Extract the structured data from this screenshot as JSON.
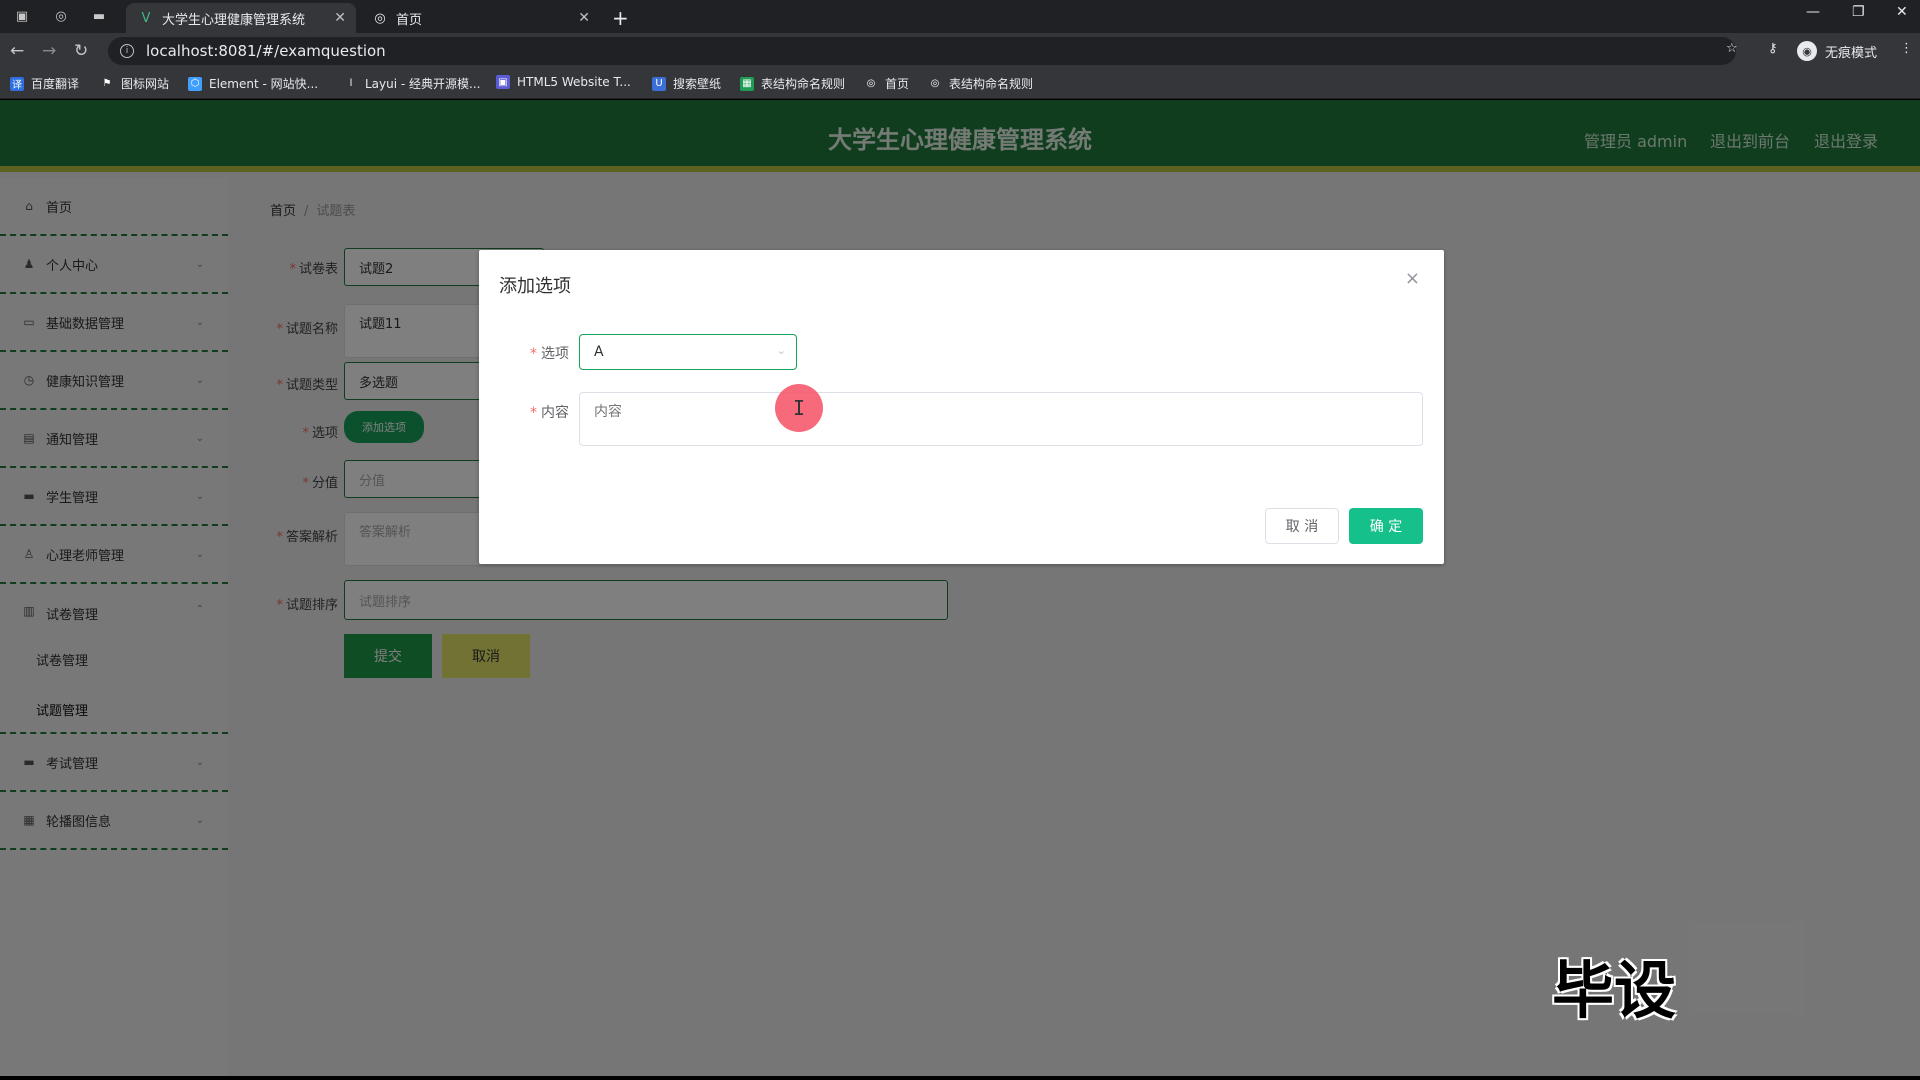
{
  "browser": {
    "tabs": [
      {
        "label": "大学生心理健康管理系统",
        "active": true
      },
      {
        "label": "首页",
        "active": false
      }
    ],
    "url": "localhost:8081/#/examquestion",
    "incognito_label": "无痕模式",
    "bookmarks": [
      {
        "label": "百度翻译",
        "color": "#2f6fe0",
        "glyph": "译"
      },
      {
        "label": "图标网站",
        "color": "#35363a",
        "glyph": "⚑"
      },
      {
        "label": "Element - 网站快...",
        "color": "#409eff",
        "glyph": "⬡"
      },
      {
        "label": "Layui - 经典开源模...",
        "color": "#35363a",
        "glyph": "l"
      },
      {
        "label": "HTML5 Website T...",
        "color": "#5b5bd6",
        "glyph": "▣"
      },
      {
        "label": "搜索壁纸",
        "color": "#3a6fd8",
        "glyph": "U"
      },
      {
        "label": "表结构命名规则",
        "color": "#1f9d55",
        "glyph": "▦"
      },
      {
        "label": "首页",
        "color": "#35363a",
        "glyph": "◎"
      },
      {
        "label": "表结构命名规则",
        "color": "#35363a",
        "glyph": "◎"
      }
    ]
  },
  "header": {
    "title": "大学生心理健康管理系统",
    "admin": "管理员 admin",
    "front": "退出到前台",
    "logout": "退出登录"
  },
  "sidebar": {
    "items": [
      {
        "label": "首页",
        "icon": "⌂"
      },
      {
        "label": "个人中心",
        "icon": "♟"
      },
      {
        "label": "基础数据管理",
        "icon": "▭"
      },
      {
        "label": "健康知识管理",
        "icon": "◷"
      },
      {
        "label": "通知管理",
        "icon": "▤"
      },
      {
        "label": "学生管理",
        "icon": "▬"
      },
      {
        "label": "心理老师管理",
        "icon": "♙"
      },
      {
        "label": "试卷管理",
        "icon": "▥"
      }
    ],
    "sub_items": [
      "试卷管理",
      "试题管理"
    ],
    "items_after": [
      {
        "label": "考试管理",
        "icon": "▬"
      },
      {
        "label": "轮播图信息",
        "icon": "▦"
      }
    ]
  },
  "breadcrumb": {
    "home": "首页",
    "sep": "/",
    "current": "试题表"
  },
  "form": {
    "paper_label": "试卷表",
    "paper_value": "试题2",
    "name_label": "试题名称",
    "name_value": "试题11",
    "type_label": "试题类型",
    "type_value": "多选题",
    "option_label": "选项",
    "add_option": "添加选项",
    "score_label": "分值",
    "score_placeholder": "分值",
    "analysis_label": "答案解析",
    "analysis_placeholder": "答案解析",
    "sort_label": "试题排序",
    "sort_placeholder": "试题排序",
    "submit": "提交",
    "cancel": "取消"
  },
  "dialog": {
    "title": "添加选项",
    "close": "×",
    "option_label": "选项",
    "option_value": "A",
    "content_label": "内容",
    "content_placeholder": "内容",
    "cancel": "取 消",
    "ok": "确 定"
  },
  "cursor": {
    "glyph": "I"
  },
  "watermark": {
    "text": "毕设"
  }
}
